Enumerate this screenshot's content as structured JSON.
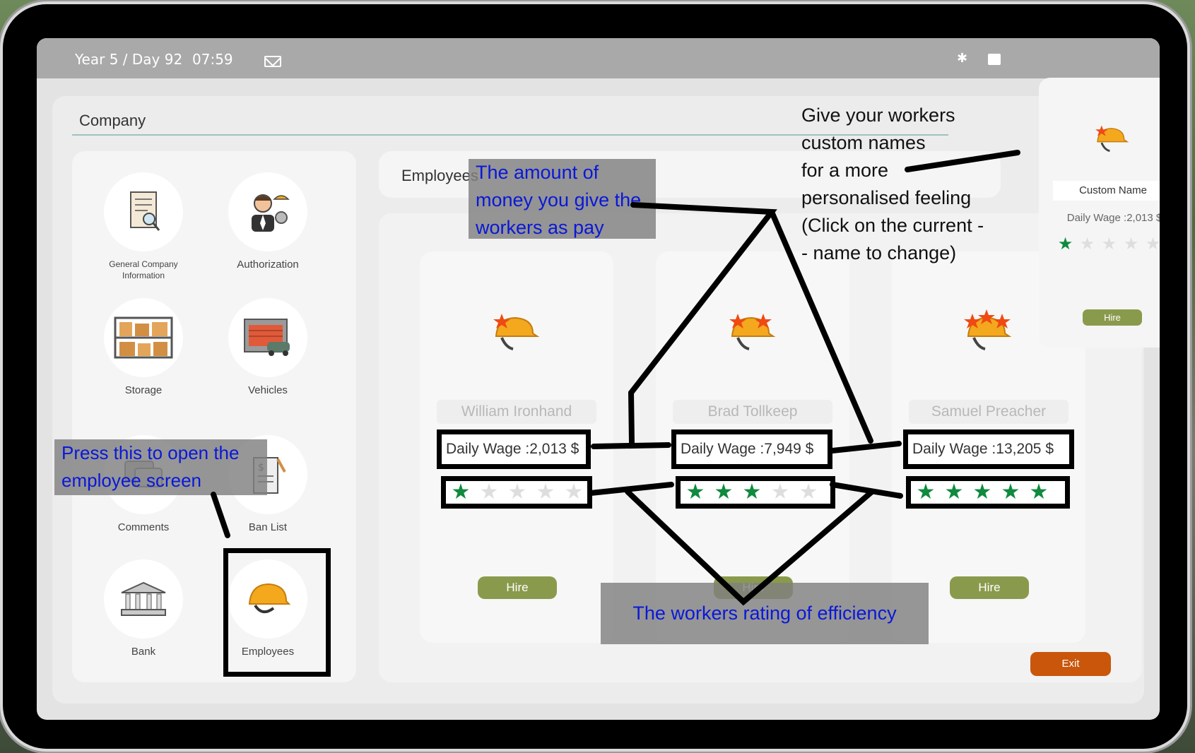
{
  "topbar": {
    "date": "Year 5 / Day 92",
    "time": "07:59",
    "icons": [
      "mail-icon",
      "bluetooth-icon",
      "system-icon"
    ]
  },
  "company": {
    "title": "Company",
    "menu": [
      {
        "label": "General Company\nInformation",
        "icon": "document-search-icon"
      },
      {
        "label": "Authorization",
        "icon": "manager-icon"
      },
      {
        "label": "Storage",
        "icon": "shelves-icon"
      },
      {
        "label": "Vehicles",
        "icon": "garage-icon"
      },
      {
        "label": "Comments",
        "icon": "comments-icon"
      },
      {
        "label": "Ban List",
        "icon": "ban-list-icon"
      },
      {
        "label": "Bank",
        "icon": "bank-icon"
      },
      {
        "label": "Employees",
        "icon": "hard-hat-icon"
      }
    ]
  },
  "employees": {
    "header": "Employees",
    "cards": [
      {
        "name": "William Ironhand",
        "wage": "Daily Wage :2,013 $",
        "rating": 1,
        "hire": "Hire"
      },
      {
        "name": "Brad Tollkeep",
        "wage": "Daily Wage :7,949 $",
        "rating": 3,
        "hire": "Hire"
      },
      {
        "name": "Samuel Preacher",
        "wage": "Daily Wage :13,205 $",
        "rating": 5,
        "hire": "Hire"
      }
    ],
    "exit": "Exit"
  },
  "popup": {
    "custom_name": "Custom Name",
    "wage": "Daily Wage :2,013 $",
    "rating": 1,
    "hire": "Hire"
  },
  "annotations": {
    "open_screen": "Press this to open the employee screen",
    "pay": "The amount of money you give the workers as pay",
    "custom_names": "Give your workers\ncustom names\nfor a more\npersonalised feeling\n(Click on the current -\n- name to change)",
    "rating": "The workers rating of efficiency"
  },
  "colors": {
    "star_on": "#0f8a3e",
    "hire_button": "#8a9a4c",
    "exit_button": "#c9560b",
    "annotation_text": "#0a18d8"
  }
}
